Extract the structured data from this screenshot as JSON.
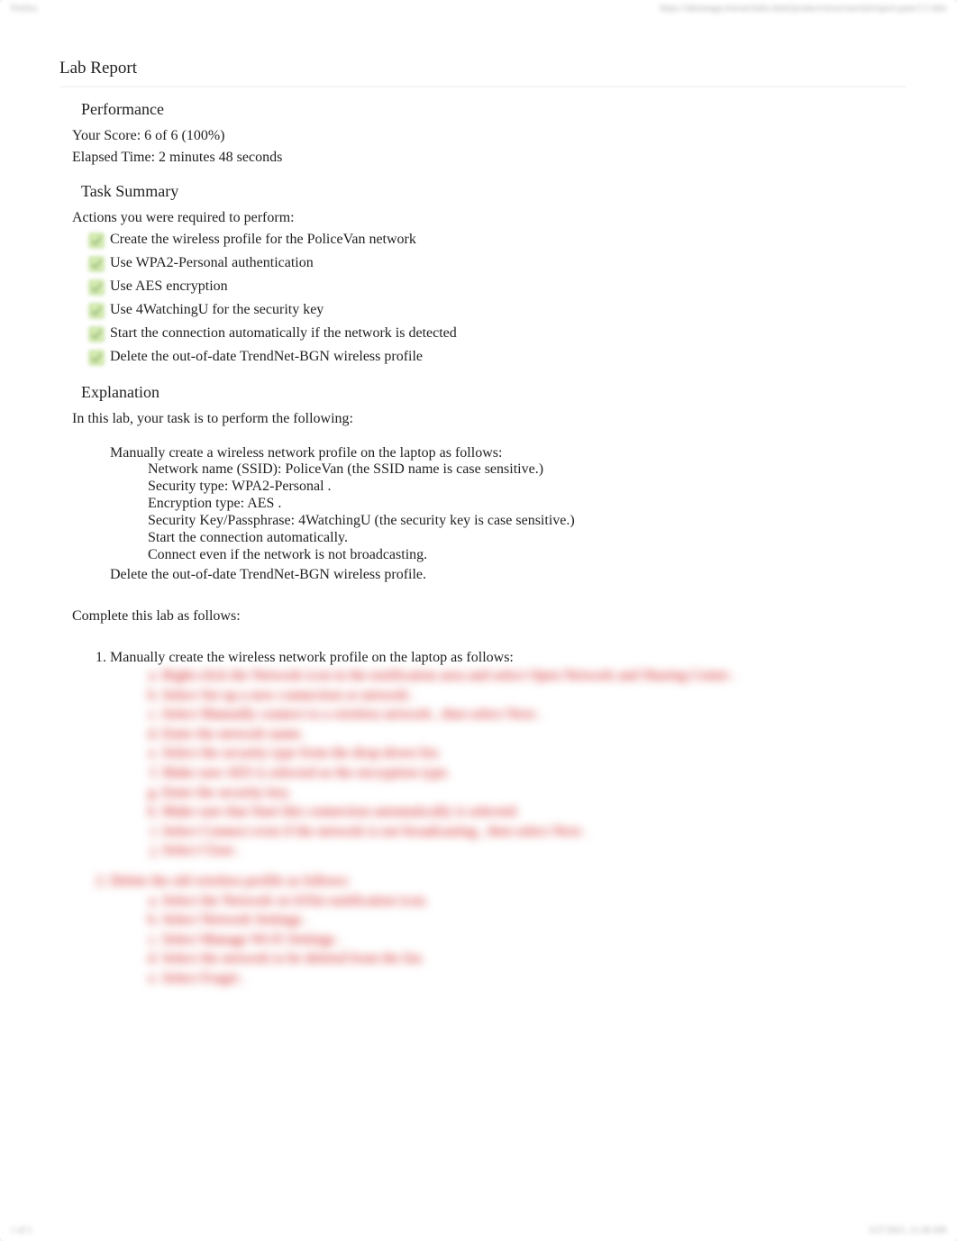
{
  "header": {
    "top_left": "Firefox",
    "top_right": "https://labsimapp.testout/index.html/productviewer/navinit/report-pane/1/1.htm"
  },
  "title": "Lab Report",
  "performance": {
    "heading": "Performance",
    "score_line": "Your Score: 6 of 6 (100%)",
    "elapsed_line": "Elapsed Time: 2 minutes 48 seconds"
  },
  "task_summary": {
    "heading": "Task Summary",
    "intro": "Actions you were required to perform:",
    "items": [
      "Create the wireless profile for the PoliceVan network",
      "Use WPA2-Personal authentication",
      "Use AES encryption",
      "Use 4WatchingU for the security key",
      "Start the connection automatically if the network is detected",
      "Delete the out-of-date TrendNet-BGN wireless profile"
    ]
  },
  "explanation": {
    "heading": "Explanation",
    "intro": "In this lab, your task is to perform the following:",
    "bullets": [
      {
        "text": "Manually create a wireless network profile on the laptop as follows:",
        "sub": [
          "Network name (SSID): PoliceVan  (the SSID name is case sensitive.)",
          "Security type: WPA2-Personal  .",
          "Encryption type: AES .",
          "Security Key/Passphrase: 4WatchingU   (the security key is case sensitive.)",
          "Start the connection automatically.",
          "Connect even if the network is not broadcasting."
        ]
      },
      {
        "text": "Delete the out-of-date TrendNet-BGN   wireless profile."
      }
    ],
    "complete": "Complete this lab as follows:",
    "steps": [
      {
        "text": "Manually create the wireless network profile on the laptop as follows:",
        "sub": [
          "Right-click the Network   icon in the notification area and select Open Network and Sharing Center  .",
          "Select Set up a new connection or network  .",
          "Select Manually connect to a wireless network  , then select Next  .",
          "Enter the network name.",
          "Select the security type from the drop-down list.",
          "Make sure AES   is selected as the encryption type.",
          "Enter the security key.",
          "Make sure that Start this connection automatically    is selected.",
          "Select Connect even if the network is not broadcasting  , then select Next  .",
          "Select Close  ."
        ]
      },
      {
        "text": "Delete the old wireless profile as follows:",
        "sub": [
          "Select the Network   wi-fi/list notification icon.",
          "Select Network Settings  .",
          "Select Manage Wi-Fi Settings  .",
          "Select the network to be deleted from the list.",
          "Select Forget  ."
        ]
      }
    ]
  },
  "footer": {
    "left": "1 of 1",
    "right": "5/27/2021, 11:28 AM"
  }
}
